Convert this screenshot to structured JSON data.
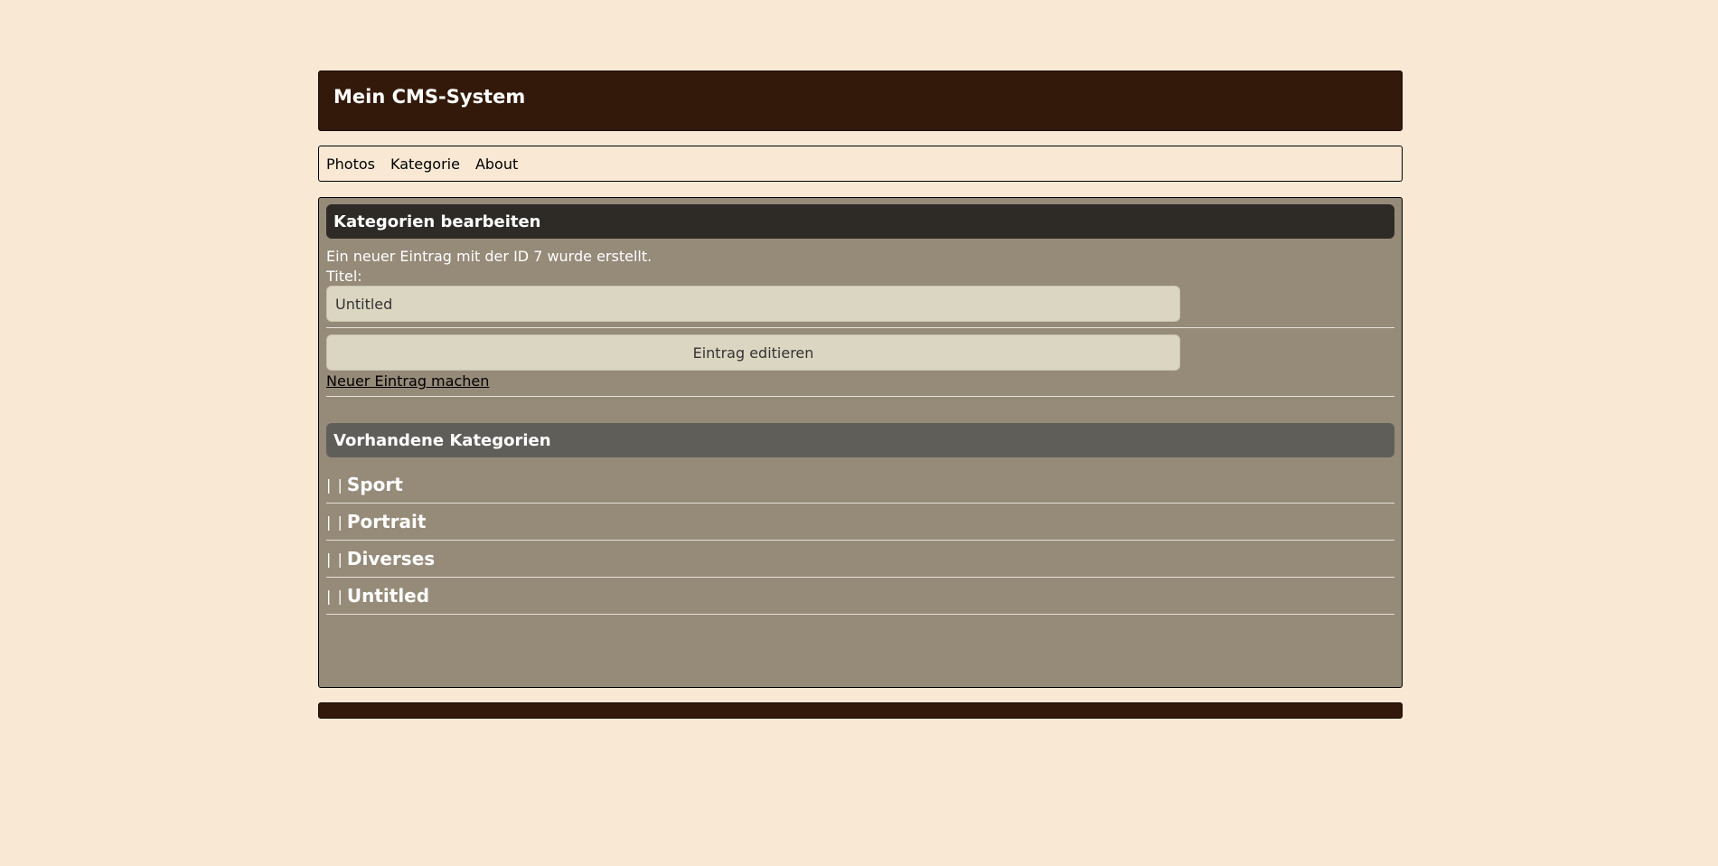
{
  "header": {
    "title": "Mein CMS-System"
  },
  "nav": {
    "items": [
      {
        "label": "Photos"
      },
      {
        "label": "Kategorie"
      },
      {
        "label": "About"
      }
    ]
  },
  "edit": {
    "heading": "Kategorien bearbeiten",
    "message": "Ein neuer Eintrag mit der ID 7 wurde erstellt.",
    "title_label": "Titel:",
    "title_value": "Untitled",
    "submit_label": "Eintrag editieren",
    "new_link": "Neuer Eintrag machen"
  },
  "categories": {
    "heading": "Vorhandene Kategorien",
    "separator": "| |",
    "items": [
      {
        "name": "Sport"
      },
      {
        "name": "Portrait"
      },
      {
        "name": "Diverses"
      },
      {
        "name": "Untitled"
      }
    ]
  },
  "colors": {
    "background": "#f9e9d4",
    "header": "#33190a",
    "content": "#968a79",
    "section_dark": "#2e2b27",
    "section_grey": "#605e59",
    "input": "#dbd6c1"
  }
}
